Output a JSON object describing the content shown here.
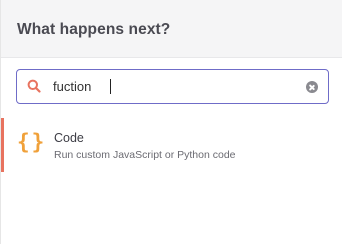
{
  "header": {
    "title": "What happens next?"
  },
  "search": {
    "value": "fuction",
    "icon": "search-icon",
    "clear_icon": "clear-icon",
    "border_color": "#6f6cc8"
  },
  "results": [
    {
      "icon": "code-braces-icon",
      "icon_glyph": "{}",
      "title": "Code",
      "description": "Run custom JavaScript or Python code",
      "accent_color": "#e8735f",
      "icon_color": "#f0a13a"
    }
  ]
}
